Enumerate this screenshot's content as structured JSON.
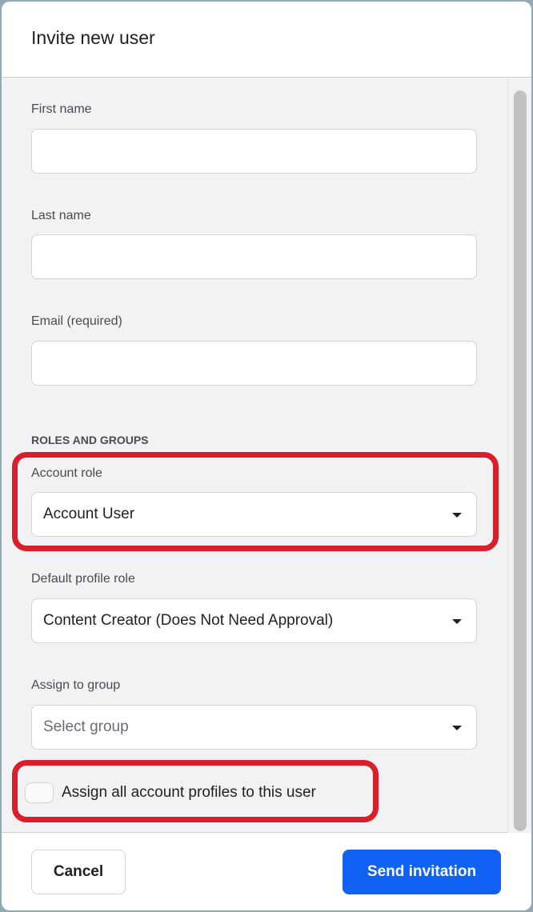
{
  "dialog": {
    "title": "Invite new user"
  },
  "form": {
    "first_name": {
      "label": "First name",
      "value": ""
    },
    "last_name": {
      "label": "Last name",
      "value": ""
    },
    "email": {
      "label": "Email (required)",
      "value": ""
    },
    "section_heading": "ROLES AND GROUPS",
    "account_role": {
      "label": "Account role",
      "value": "Account User"
    },
    "default_profile_role": {
      "label": "Default profile role",
      "value": "Content Creator (Does Not Need Approval)"
    },
    "assign_group": {
      "label": "Assign to group",
      "placeholder": "Select group"
    },
    "assign_all": {
      "label": "Assign all account profiles to this user",
      "checked": false
    }
  },
  "footer": {
    "cancel": "Cancel",
    "send": "Send invitation"
  },
  "colors": {
    "highlight": "#d91f2a",
    "primary": "#1062f5"
  }
}
